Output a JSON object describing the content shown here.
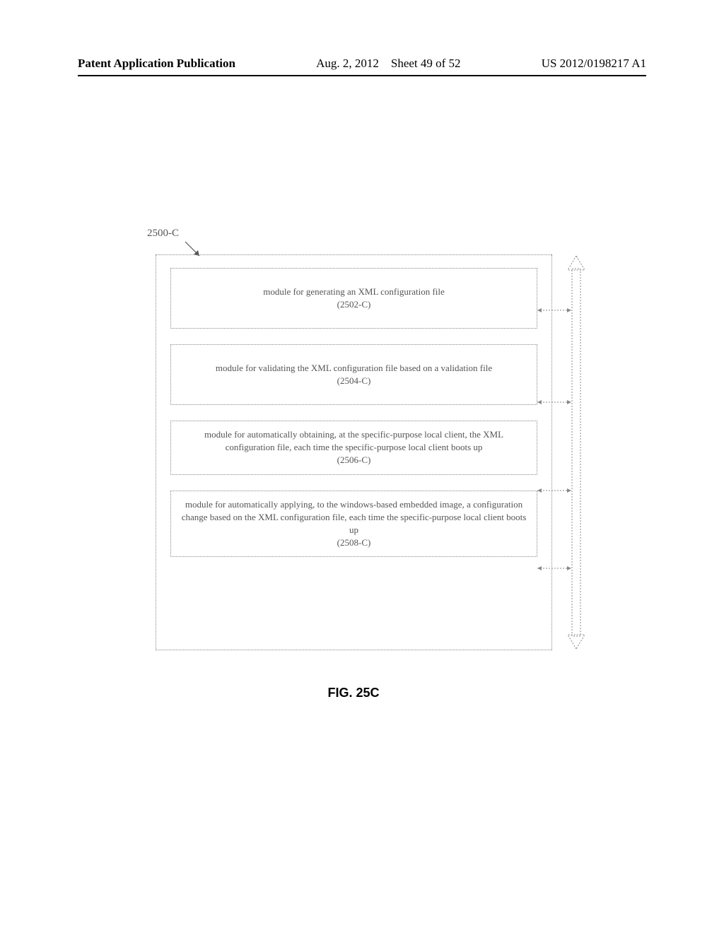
{
  "header": {
    "left": "Patent Application Publication",
    "date": "Aug. 2, 2012",
    "sheet": "Sheet 49 of 52",
    "pubno": "US 2012/0198217 A1"
  },
  "figure": {
    "ref": "2500-C",
    "caption": "FIG. 25C",
    "modules": [
      {
        "text": "module for generating an XML configuration file",
        "num": "(2502-C)"
      },
      {
        "text": "module for validating the XML configuration file based on a validation file",
        "num": "(2504-C)"
      },
      {
        "text": "module for automatically obtaining, at the specific-purpose local client, the XML configuration file, each time the specific-purpose local client boots up",
        "num": "(2506-C)"
      },
      {
        "text": "module for automatically applying, to the windows-based embedded image, a configuration change based on the XML configuration file, each time the specific-purpose local client boots up",
        "num": "(2508-C)"
      }
    ]
  }
}
